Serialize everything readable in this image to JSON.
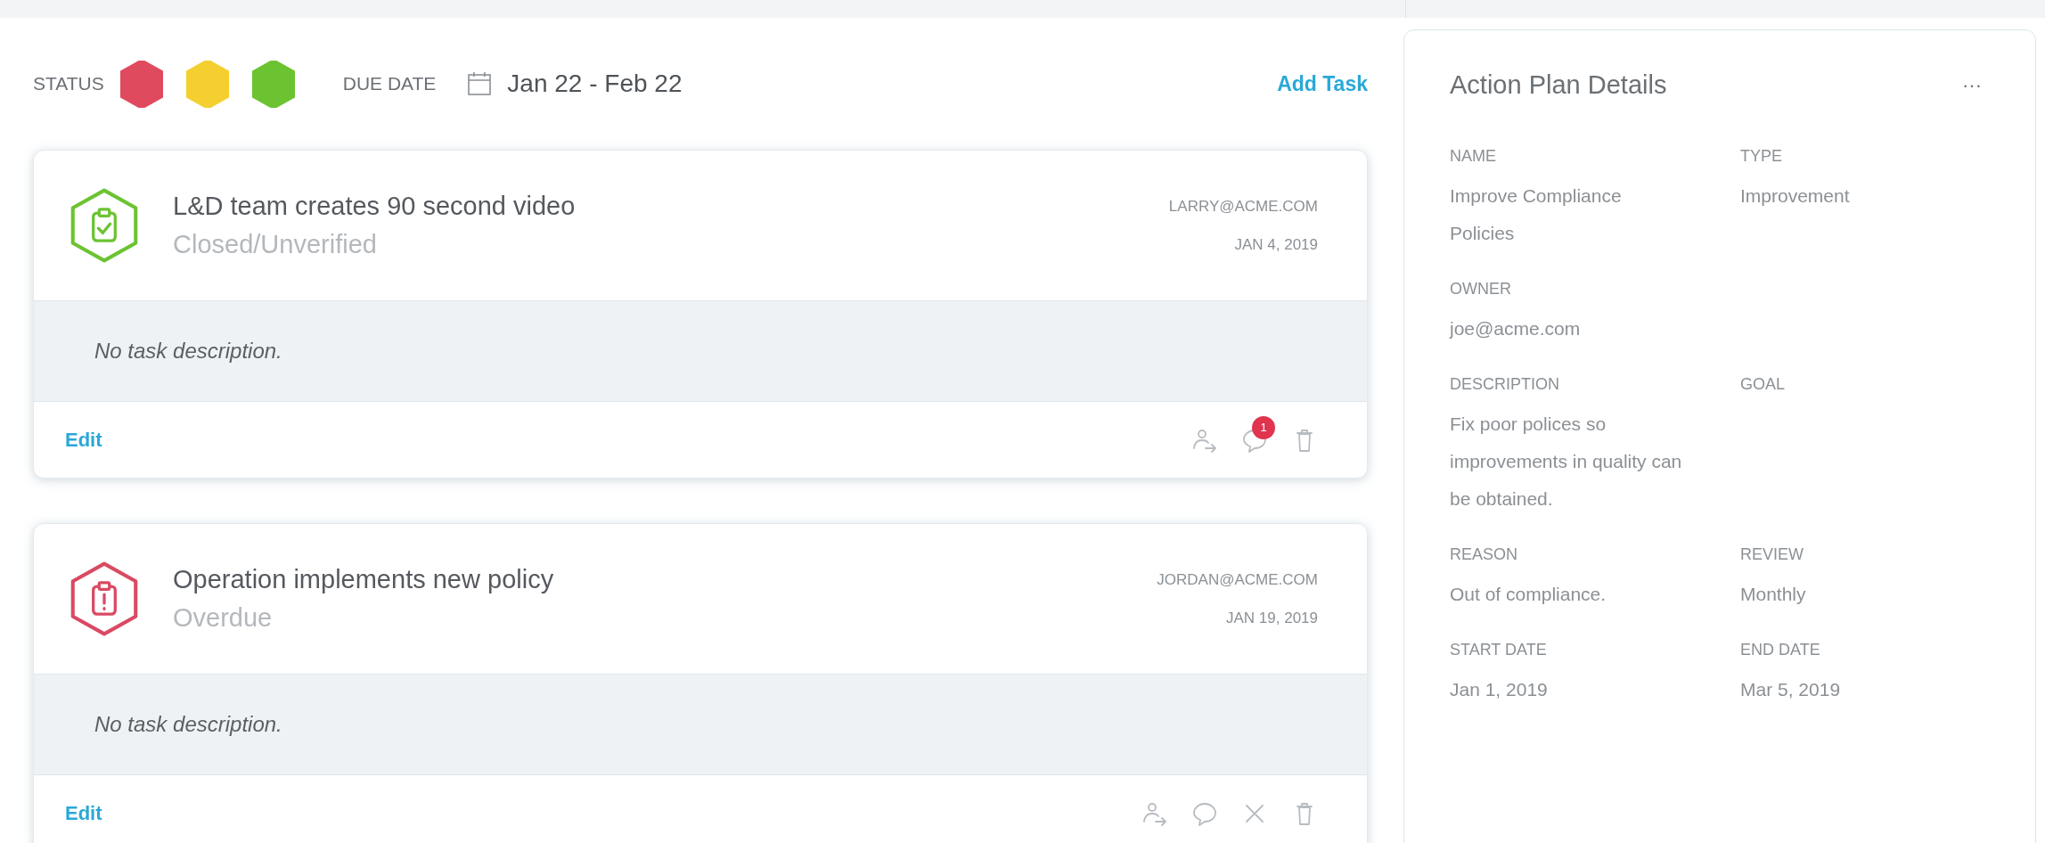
{
  "filters": {
    "status_label": "STATUS",
    "statuses": [
      {
        "color": "#e04a5f"
      },
      {
        "color": "#f5cf2f"
      },
      {
        "color": "#6cc332"
      }
    ],
    "due_label": "DUE DATE",
    "date_range": "Jan 22 - Feb 22",
    "add_task": "Add Task"
  },
  "tasks": [
    {
      "title": "L&D team creates 90 second video",
      "status": "Closed/Unverified",
      "kind": "closed",
      "color": "#6cc332",
      "assignee": "LARRY@ACME.COM",
      "date": "JAN 4, 2019",
      "description": "No task description.",
      "edit": "Edit",
      "actions": [
        {
          "kind": "reassign"
        },
        {
          "kind": "comment",
          "badge": "1"
        },
        {
          "kind": "delete"
        }
      ]
    },
    {
      "title": "Operation implements new policy",
      "status": "Overdue",
      "kind": "overdue",
      "color": "#d94a63",
      "assignee": "JORDAN@ACME.COM",
      "date": "JAN 19, 2019",
      "description": "No task description.",
      "edit": "Edit",
      "actions": [
        {
          "kind": "reassign"
        },
        {
          "kind": "comment"
        },
        {
          "kind": "close"
        },
        {
          "kind": "delete"
        }
      ]
    }
  ],
  "details": {
    "title": "Action Plan Details",
    "menu": "···",
    "rows": [
      [
        {
          "label": "NAME",
          "value": "Improve Compliance Policies"
        },
        {
          "label": "TYPE",
          "value": "Improvement"
        }
      ],
      [
        {
          "label": "OWNER",
          "value": "joe@acme.com"
        }
      ],
      [
        {
          "label": "DESCRIPTION",
          "value": "Fix poor polices so improvements in quality can be obtained."
        },
        {
          "label": "GOAL"
        }
      ],
      [
        {
          "label": "REASON",
          "value": "Out of compliance."
        },
        {
          "label": "REVIEW",
          "value": "Monthly"
        }
      ],
      [
        {
          "label": "START DATE",
          "value": "Jan 1, 2019"
        },
        {
          "label": "END DATE",
          "value": "Mar 5, 2019"
        }
      ]
    ]
  }
}
